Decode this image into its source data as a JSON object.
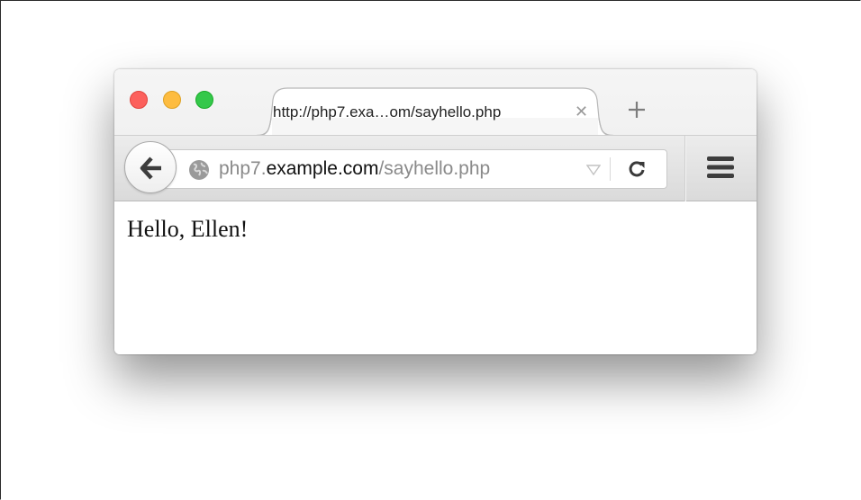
{
  "tab": {
    "title": "http://php7.exa…om/sayhello.php",
    "close_icon": "close-icon"
  },
  "address_bar": {
    "url_prefix": "php7.",
    "url_host": "example.com",
    "url_path": "/sayhello.php"
  },
  "page": {
    "text": "Hello, Ellen!"
  },
  "colors": {
    "close_red": "#fc605c",
    "minimize_yellow": "#fdbc40",
    "zoom_green": "#34c84a"
  }
}
